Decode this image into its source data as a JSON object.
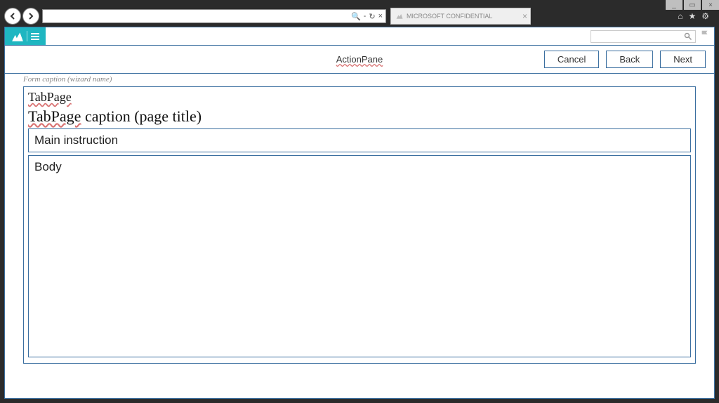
{
  "window_controls": {
    "minimize": "_",
    "restore": "▭",
    "close": "×"
  },
  "browser": {
    "address_value": "",
    "search_glyph": "🔍",
    "refresh_glyph": "↻",
    "stop_glyph": "×",
    "tab_label": "MICROSOFT CONFIDENTIAL",
    "tab_close_glyph": "×"
  },
  "system_icons": {
    "home": "⌂",
    "star": "★",
    "gear": "⚙"
  },
  "app_header": {
    "logo_name": "dynamics-logo",
    "search_placeholder": "",
    "flag_name": "flag-icon"
  },
  "action_pane": {
    "label": "ActionPane",
    "buttons": {
      "cancel": "Cancel",
      "back": "Back",
      "next": "Next"
    }
  },
  "form": {
    "caption": "Form caption (wizard name)",
    "tabpage_label": "TabPage",
    "tabpage_title_prefix": "TabPage",
    "tabpage_title_suffix": " caption (page title)",
    "main_instruction": "Main instruction",
    "body": "Body"
  }
}
